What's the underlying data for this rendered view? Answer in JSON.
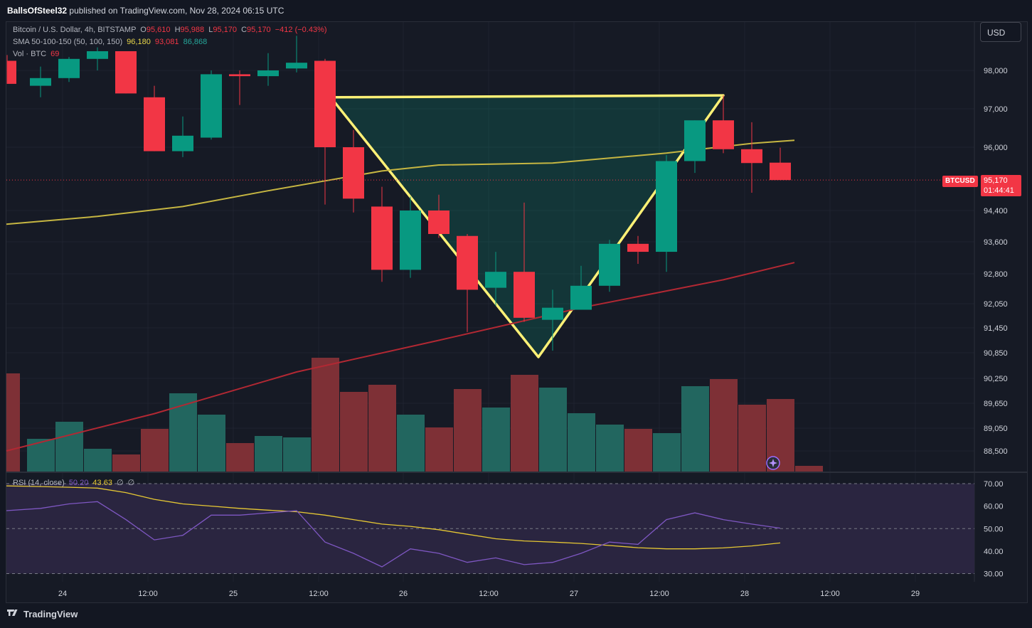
{
  "publisher": {
    "user": "BallsOfSteel32",
    "text": "published on TradingView.com, Nov 28, 2024 06:15 UTC"
  },
  "legend": {
    "symbol": "Bitcoin / U.S. Dollar, 4h, BITSTAMP",
    "o_label": "O",
    "o_value": "95,610",
    "h_label": "H",
    "h_value": "95,988",
    "l_label": "L",
    "l_value": "95,170",
    "c_label": "C",
    "c_value": "95,170",
    "change": "−412 (−0.43%)",
    "sma_label": "SMA 50-100-150 (50, 100, 150)",
    "sma_50": "96,180",
    "sma_100": "93,081",
    "sma_150": "86,868",
    "vol_label": "Vol · BTC",
    "vol_value": "69",
    "rsi_label": "RSI (14, close)",
    "rsi_value": "50.20",
    "rsi_ma": "43.63",
    "rsi_x1": "∅",
    "rsi_x2": "∅"
  },
  "currency_button": "USD",
  "price_tag": {
    "symbol": "BTCUSD",
    "price": "95,170",
    "countdown": "01:44:41"
  },
  "footer": {
    "brand": "TradingView"
  },
  "colors": {
    "up": "#089981",
    "down": "#f23645",
    "sma50": "#c6b642",
    "sma100": "#b22833",
    "pattern_line": "#fff176",
    "rsi_line": "#7e57c2",
    "rsi_ma": "#e6c833",
    "rsi_band": "#2a2540"
  },
  "chart_data": {
    "type": "candlestick",
    "price_axis_ticks": [
      "98,000",
      "97,000",
      "96,000",
      "94,400",
      "93,600",
      "92,800",
      "92,050",
      "91,450",
      "90,850",
      "90,250",
      "89,650",
      "89,050",
      "88,500"
    ],
    "time_axis_ticks": [
      "24",
      "12:00",
      "25",
      "12:00",
      "26",
      "12:00",
      "27",
      "12:00",
      "28",
      "12:00",
      "29"
    ],
    "rsi_axis_ticks": [
      "70.00",
      "60.00",
      "50.00",
      "40.00",
      "30.00"
    ],
    "candles": [
      {
        "o": 98250,
        "h": 98400,
        "l": 97650,
        "c": 97650
      },
      {
        "o": 97600,
        "h": 98100,
        "l": 97300,
        "c": 97800
      },
      {
        "o": 97800,
        "h": 98350,
        "l": 97700,
        "c": 98300
      },
      {
        "o": 98300,
        "h": 98600,
        "l": 98000,
        "c": 98500
      },
      {
        "o": 98500,
        "h": 98500,
        "l": 97400,
        "c": 97400
      },
      {
        "o": 97300,
        "h": 97600,
        "l": 95900,
        "c": 95900
      },
      {
        "o": 95900,
        "h": 96800,
        "l": 95750,
        "c": 96300
      },
      {
        "o": 96250,
        "h": 98000,
        "l": 96200,
        "c": 97900
      },
      {
        "o": 97900,
        "h": 98000,
        "l": 97100,
        "c": 97850
      },
      {
        "o": 97850,
        "h": 98450,
        "l": 97600,
        "c": 98000
      },
      {
        "o": 98050,
        "h": 98900,
        "l": 97950,
        "c": 98200
      },
      {
        "o": 98250,
        "h": 98300,
        "l": 94550,
        "c": 96000
      },
      {
        "o": 96000,
        "h": 96450,
        "l": 94350,
        "c": 94700
      },
      {
        "o": 94500,
        "h": 95000,
        "l": 92600,
        "c": 92900
      },
      {
        "o": 92900,
        "h": 94750,
        "l": 92700,
        "c": 94400
      },
      {
        "o": 94400,
        "h": 94800,
        "l": 93700,
        "c": 93800
      },
      {
        "o": 93750,
        "h": 93800,
        "l": 91350,
        "c": 92400
      },
      {
        "o": 92450,
        "h": 93350,
        "l": 92000,
        "c": 92850
      },
      {
        "o": 92850,
        "h": 94600,
        "l": 91600,
        "c": 91700
      },
      {
        "o": 91650,
        "h": 92400,
        "l": 90900,
        "c": 91950
      },
      {
        "o": 91900,
        "h": 93000,
        "l": 91900,
        "c": 92500
      },
      {
        "o": 92500,
        "h": 93650,
        "l": 92350,
        "c": 93550
      },
      {
        "o": 93550,
        "h": 93750,
        "l": 93050,
        "c": 93350
      },
      {
        "o": 93350,
        "h": 95800,
        "l": 92850,
        "c": 95650
      },
      {
        "o": 95650,
        "h": 96700,
        "l": 95350,
        "c": 96700
      },
      {
        "o": 96700,
        "h": 97350,
        "l": 95850,
        "c": 95950
      },
      {
        "o": 95950,
        "h": 96650,
        "l": 94850,
        "c": 95600
      },
      {
        "o": 95610,
        "h": 95988,
        "l": 95170,
        "c": 95170
      }
    ],
    "volume": [
      69,
      23,
      35,
      16,
      12,
      30,
      55,
      40,
      20,
      25,
      24,
      80,
      56,
      61,
      40,
      31,
      58,
      45,
      68,
      59,
      41,
      33,
      30,
      27,
      60,
      65,
      47,
      51,
      4
    ],
    "sma50": [
      [
        0,
        94050
      ],
      [
        3,
        94250
      ],
      [
        6,
        94500
      ],
      [
        9,
        94900
      ],
      [
        11,
        95150
      ],
      [
        13,
        95400
      ],
      [
        15,
        95550
      ],
      [
        19,
        95600
      ],
      [
        23,
        95850
      ],
      [
        26,
        96100
      ],
      [
        27.5,
        96180
      ]
    ],
    "sma100": [
      [
        0,
        88500
      ],
      [
        5,
        89400
      ],
      [
        10,
        90400
      ],
      [
        15,
        91150
      ],
      [
        20,
        91950
      ],
      [
        25,
        92650
      ],
      [
        27.5,
        93081
      ]
    ],
    "pattern": [
      [
        11.2,
        97300
      ],
      [
        25,
        97350
      ],
      [
        18.5,
        90750
      ]
    ],
    "rsi": [
      58,
      59,
      61,
      62,
      54,
      45,
      47,
      56,
      56,
      57,
      58,
      44,
      39,
      33,
      41,
      39,
      35,
      37,
      34,
      35,
      39,
      44,
      43,
      54,
      57,
      54,
      52,
      50.2
    ],
    "rsi_ma": [
      69,
      68.7,
      68.4,
      68,
      66,
      63,
      61,
      60,
      59,
      58.2,
      57.5,
      56,
      54,
      52,
      51,
      49.5,
      47.5,
      45.5,
      44.5,
      44,
      43.4,
      42.5,
      41.5,
      41,
      41,
      41.4,
      42.3,
      43.63
    ],
    "rsi_levels": {
      "upper": 70,
      "middle": 50,
      "lower": 30
    }
  }
}
